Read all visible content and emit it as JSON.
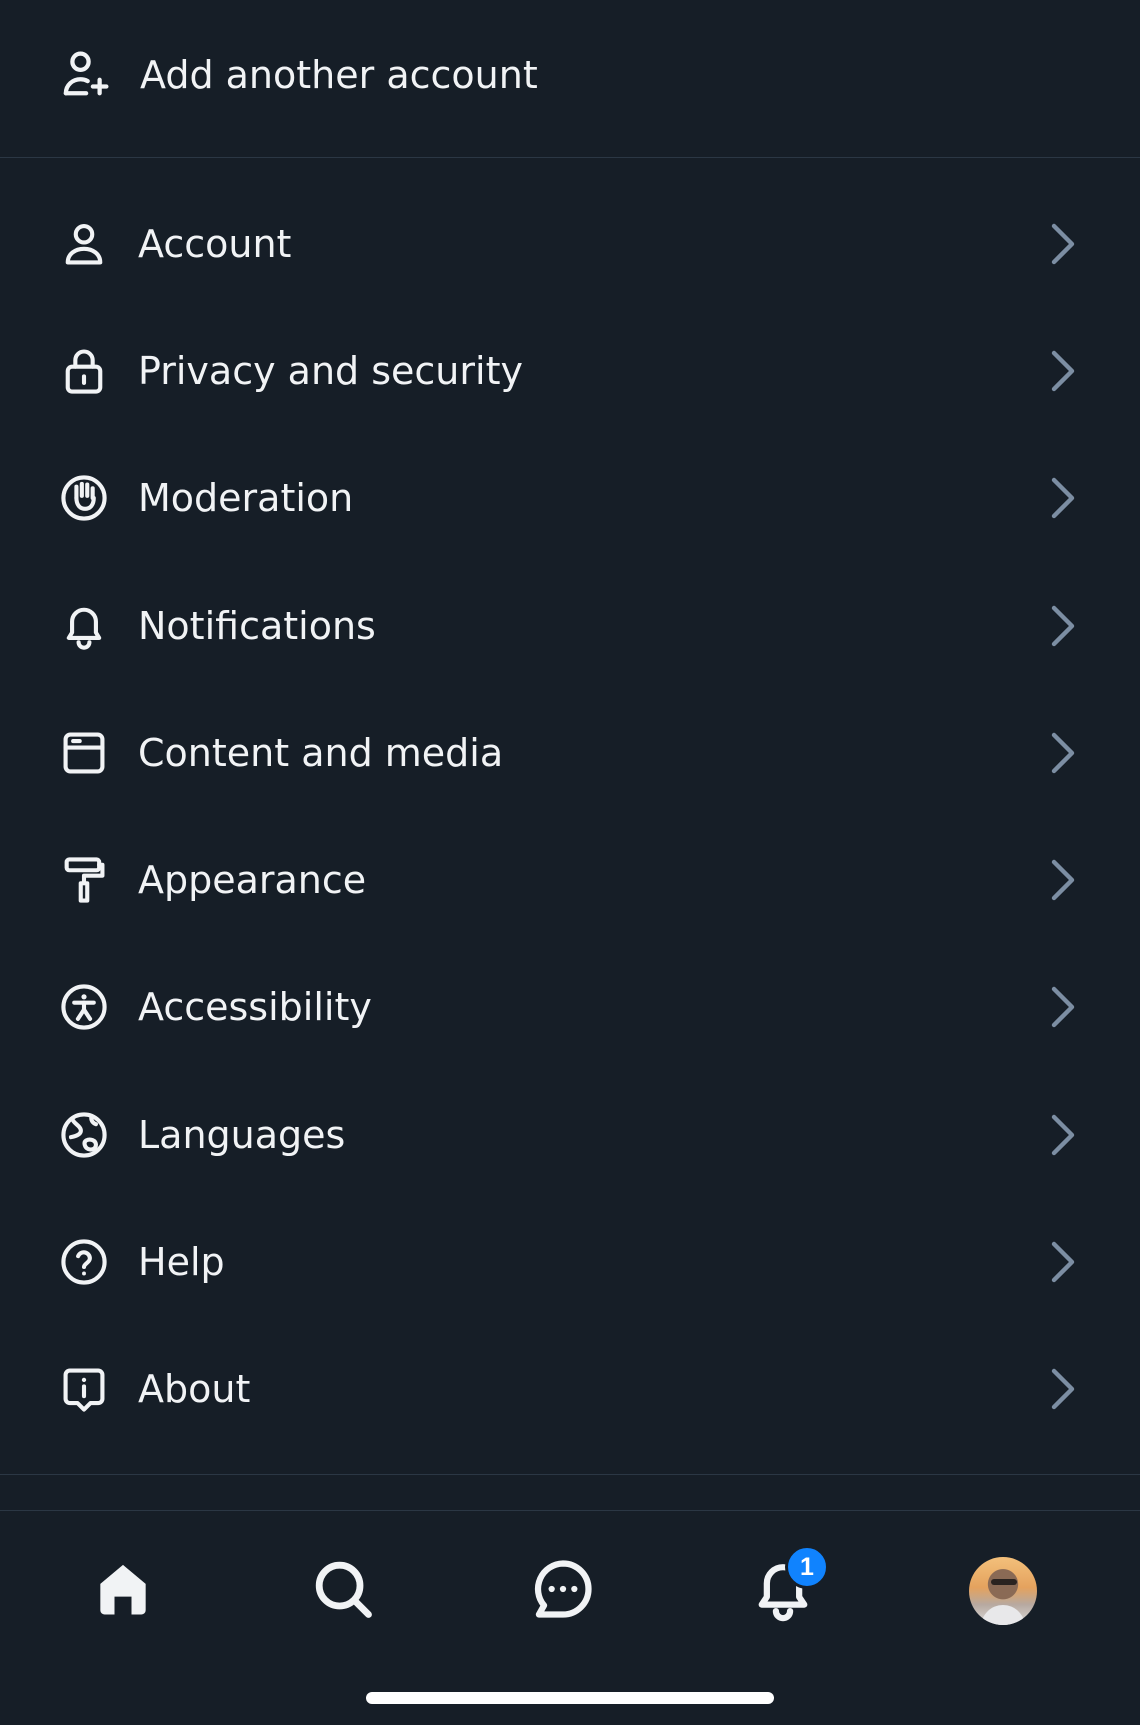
{
  "add_account": {
    "label": "Add another account",
    "icon": "user-plus-icon"
  },
  "menu": {
    "items": [
      {
        "label": "Account",
        "icon": "person-icon"
      },
      {
        "label": "Privacy and security",
        "icon": "lock-icon"
      },
      {
        "label": "Moderation",
        "icon": "hand-icon"
      },
      {
        "label": "Notifications",
        "icon": "bell-icon"
      },
      {
        "label": "Content and media",
        "icon": "browser-window-icon"
      },
      {
        "label": "Appearance",
        "icon": "paint-roller-icon"
      },
      {
        "label": "Accessibility",
        "icon": "accessibility-icon"
      },
      {
        "label": "Languages",
        "icon": "globe-icon"
      },
      {
        "label": "Help",
        "icon": "question-circle-icon"
      },
      {
        "label": "About",
        "icon": "info-bubble-icon"
      }
    ]
  },
  "tabbar": {
    "tabs": [
      {
        "name": "home",
        "icon": "home-icon"
      },
      {
        "name": "search",
        "icon": "search-icon"
      },
      {
        "name": "chat",
        "icon": "chat-bubble-icon"
      },
      {
        "name": "notifications",
        "icon": "bell-icon",
        "badge": "1"
      },
      {
        "name": "profile",
        "icon": "avatar"
      }
    ]
  },
  "colors": {
    "background": "#161e27",
    "divider": "#2b3744",
    "text": "#f1f3f5",
    "chevron": "#7c8ea3",
    "badge": "#1083fe"
  }
}
